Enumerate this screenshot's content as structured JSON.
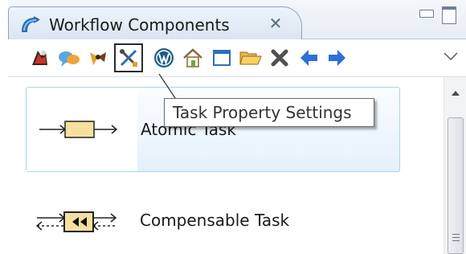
{
  "view": {
    "title": "Workflow Components",
    "close_glyph": "✕",
    "title_icon": "workflow-components-icon"
  },
  "toolbar": {
    "buttons": [
      {
        "name": "tool-1-icon"
      },
      {
        "name": "tool-2-icon"
      },
      {
        "name": "tool-3-icon"
      },
      {
        "name": "task-property-settings-icon",
        "active": true
      },
      {
        "name": "wordpress-icon"
      },
      {
        "name": "home-icon"
      },
      {
        "name": "window-icon"
      },
      {
        "name": "open-folder-icon"
      },
      {
        "name": "delete-icon"
      },
      {
        "name": "back-arrow-icon"
      },
      {
        "name": "forward-arrow-icon"
      }
    ],
    "view_menu_icon": "chevron-down-icon"
  },
  "tooltip": {
    "text": "Task Property Settings"
  },
  "list": {
    "items": [
      {
        "label": "Atomic Task",
        "selected": true,
        "icon": "atomic-task-icon"
      },
      {
        "label": "Compensable Task",
        "selected": false,
        "icon": "compensable-task-icon"
      }
    ]
  },
  "colors": {
    "selection_fill": "#e4f1fc",
    "selection_border": "#a9d4f3",
    "task_box": "#f6e0a0",
    "arrow_blue": "#2f6fd6"
  }
}
